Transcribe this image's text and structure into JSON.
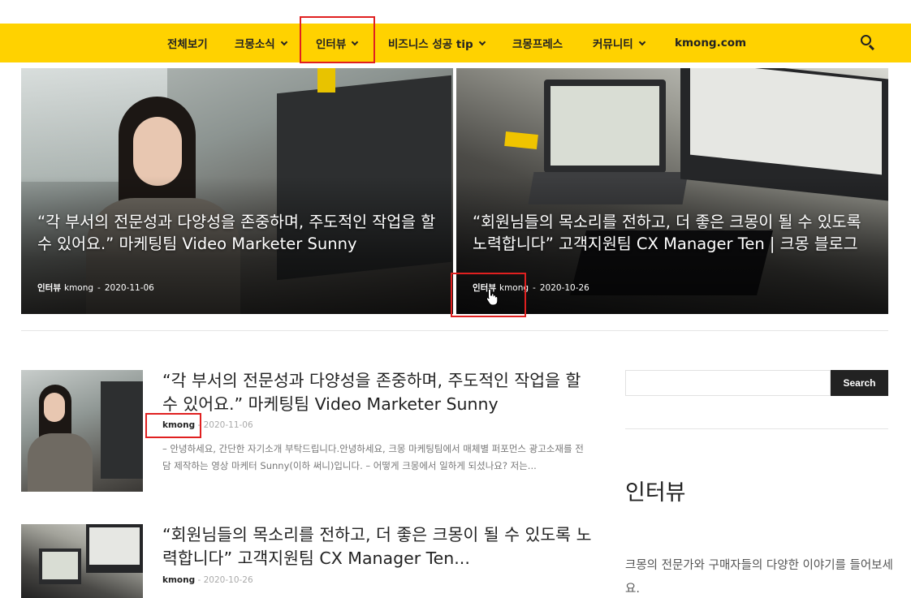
{
  "nav": {
    "items": [
      {
        "label": "전체보기",
        "has_dropdown": false
      },
      {
        "label": "크몽소식",
        "has_dropdown": true
      },
      {
        "label": "인터뷰",
        "has_dropdown": true
      },
      {
        "label": "비즈니스 성공 tip",
        "has_dropdown": true
      },
      {
        "label": "크몽프레스",
        "has_dropdown": false
      },
      {
        "label": "커뮤니티",
        "has_dropdown": true
      },
      {
        "label": "kmong.com",
        "has_dropdown": false
      }
    ],
    "search_icon": "search-icon",
    "bg_color": "#ffd200"
  },
  "featured": [
    {
      "title": "“각 부서의 전문성과 다양성을 존중하며, 주도적인 작업을 할 수 있어요.” 마케팅팀 Video Marketer Sunny",
      "category": "인터뷰",
      "author": "kmong",
      "date": "2020-11-06"
    },
    {
      "title": "“회원님들의 목소리를 전하고, 더 좋은 크몽이 될 수 있도록 노력합니다” 고객지원팀 CX Manager Ten | 크몽 블로그",
      "category": "인터뷰",
      "author": "kmong",
      "date": "2020-10-26"
    }
  ],
  "posts": [
    {
      "title": "“각 부서의 전문성과 다양성을 존중하며, 주도적인 작업을 할 수 있어요.” 마케팅팀 Video Marketer Sunny",
      "author": "kmong",
      "date": "2020-11-06",
      "excerpt": "– 안녕하세요, 간단한 자기소개 부탁드립니다.안녕하세요, 크몽 마케팅팀에서 매체별 퍼포먼스 광고소재를 전담 제작하는 영상 마케터 Sunny(이하 써니)입니다.   – 어떻게 크몽에서 일하게 되셨나요? 저는..."
    },
    {
      "title": "“회원님들의 목소리를 전하고, 더 좋은 크몽이 될 수 있도록 노력합니다” 고객지원팀 CX Manager Ten...",
      "author": "kmong",
      "date": "2020-10-26"
    }
  ],
  "sidebar": {
    "search_placeholder": "",
    "search_button": "Search",
    "title": "인터뷰",
    "description": "크몽의 전문가와 구매자들의 다양한 이야기를 들어보세요."
  },
  "highlight_color": "#e02020"
}
